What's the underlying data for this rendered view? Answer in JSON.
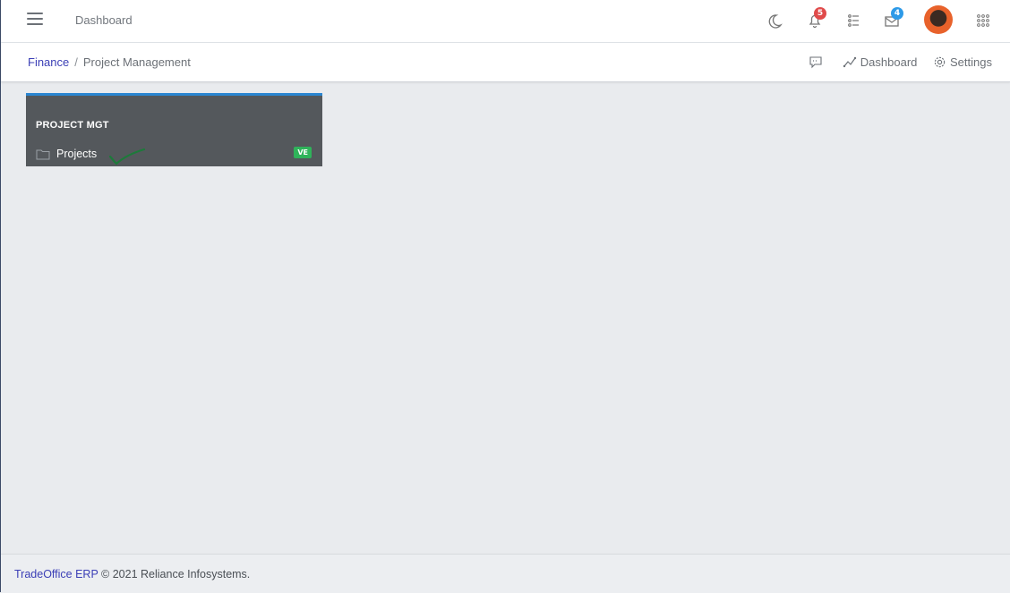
{
  "topbar": {
    "title": "Dashboard",
    "notifications_count": "5",
    "messages_count": "4",
    "icons": [
      "menu-icon",
      "moon-icon",
      "bell-icon",
      "list-icon",
      "envelope-icon",
      "apps-grid-icon"
    ]
  },
  "breadcrumb": {
    "parent": "Finance",
    "separator": "/",
    "current": "Project Management"
  },
  "actions": {
    "dashboard_label": "Dashboard",
    "settings_label": "Settings"
  },
  "card": {
    "title": "PROJECT MGT",
    "items": [
      {
        "label": "Projects",
        "badge": "VE"
      }
    ]
  },
  "footer": {
    "brand": "TradeOffice ERP",
    "text": "© 2021 Reliance Infosystems."
  },
  "colors": {
    "accent": "#2a86d1",
    "link": "#3b3fb6",
    "card_bg": "#54585c",
    "badge_green": "#2fb35a",
    "badge_red": "#e04b4b",
    "badge_blue": "#2d9ae8"
  }
}
